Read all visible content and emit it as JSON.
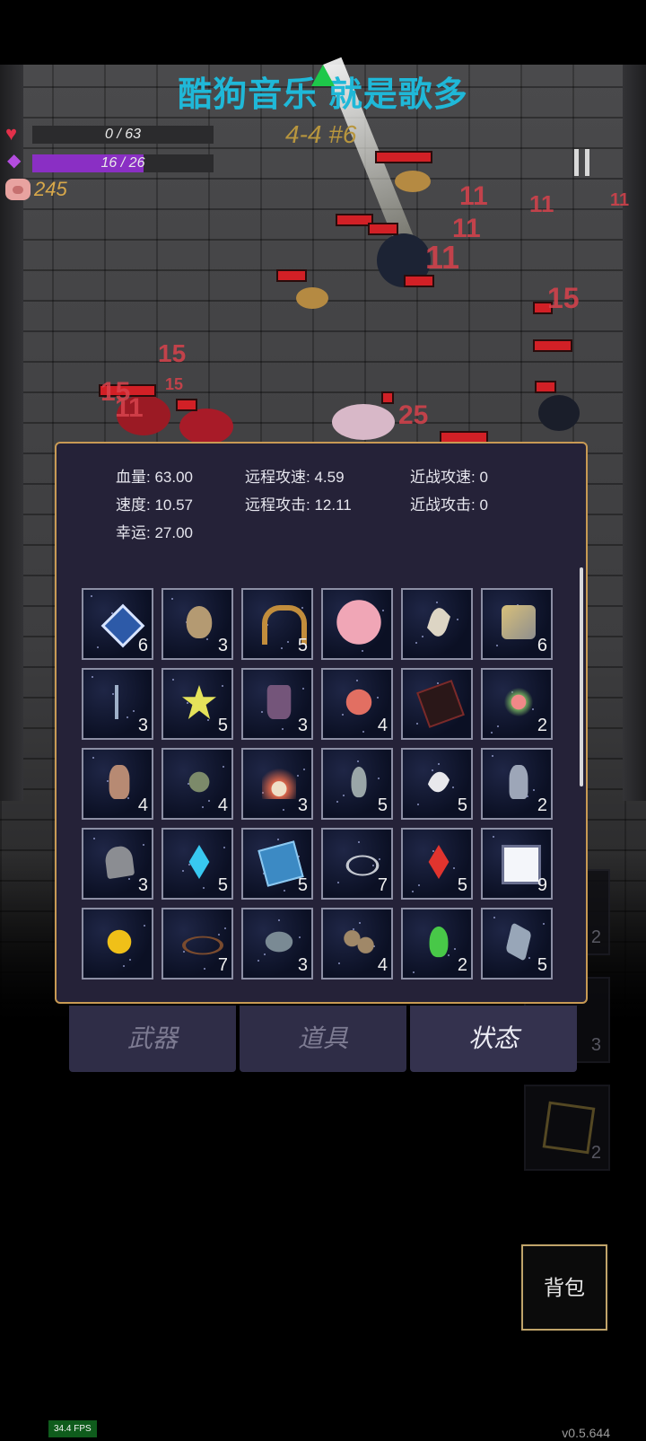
{
  "overlay": {
    "watermark": "酷狗音乐  就是歌多"
  },
  "hud": {
    "hp_text": "0 / 63",
    "hp_fraction": 0.0,
    "mana_text": "16 / 26",
    "mana_fraction": 0.615,
    "coins": "245",
    "stage": "4-4 #6",
    "hp_color": "#e2304a",
    "mana_color": "#8a2fc4"
  },
  "damage_numbers": [
    "11",
    "11",
    "11",
    "11",
    "11",
    "15",
    "15",
    "15",
    "11",
    "15",
    "25"
  ],
  "stats": {
    "hp": {
      "label": "血量:",
      "value": "63.00"
    },
    "ranged_speed": {
      "label": "远程攻速:",
      "value": "4.59"
    },
    "melee_speed": {
      "label": "近战攻速:",
      "value": "0"
    },
    "speed": {
      "label": "速度:",
      "value": "10.57"
    },
    "ranged_attack": {
      "label": "远程攻击:",
      "value": "12.11"
    },
    "melee_attack": {
      "label": "近战攻击:",
      "value": "0"
    },
    "luck": {
      "label": "幸运:",
      "value": "27.00"
    }
  },
  "items": [
    {
      "icon": "blue-diamond-icon",
      "count": "6"
    },
    {
      "icon": "egg-icon",
      "count": "3"
    },
    {
      "icon": "horseshoe-icon",
      "count": "5"
    },
    {
      "icon": "piggy-bank-icon",
      "count": ""
    },
    {
      "icon": "fang-icon",
      "count": ""
    },
    {
      "icon": "gold-stones-icon",
      "count": "6"
    },
    {
      "icon": "arrow-hook-icon",
      "count": "3"
    },
    {
      "icon": "spiked-star-icon",
      "count": "5"
    },
    {
      "icon": "boots-icon",
      "count": "3"
    },
    {
      "icon": "apple-icon",
      "count": "4"
    },
    {
      "icon": "demon-book-icon",
      "count": ""
    },
    {
      "icon": "flower-garland-icon",
      "count": "2"
    },
    {
      "icon": "vase-icon",
      "count": "4"
    },
    {
      "icon": "tentacle-icon",
      "count": "4"
    },
    {
      "icon": "feather-mask-icon",
      "count": "3"
    },
    {
      "icon": "flask-icon",
      "count": "5"
    },
    {
      "icon": "quill-icon",
      "count": "5"
    },
    {
      "icon": "ghost-cloak-icon",
      "count": "2"
    },
    {
      "icon": "tombstone-icon",
      "count": "3"
    },
    {
      "icon": "crystal-shard-icon",
      "count": "5"
    },
    {
      "icon": "spellbook-icon",
      "count": "5"
    },
    {
      "icon": "rings-icon",
      "count": "7"
    },
    {
      "icon": "red-crystal-icon",
      "count": "5"
    },
    {
      "icon": "medkit-icon",
      "count": "9"
    },
    {
      "icon": "gold-coin-icon",
      "count": ""
    },
    {
      "icon": "thorn-crown-icon",
      "count": "7"
    },
    {
      "icon": "rock-icon",
      "count": "3"
    },
    {
      "icon": "pebbles-icon",
      "count": "4"
    },
    {
      "icon": "green-potion-icon",
      "count": "2"
    },
    {
      "icon": "hammer-icon",
      "count": "5"
    }
  ],
  "tabs": {
    "weapons": "武器",
    "props": "道具",
    "status": "状态"
  },
  "side_slots": [
    {
      "count": "2"
    },
    {
      "count": "3"
    },
    {
      "count": "2"
    }
  ],
  "backpack_label": "背包",
  "fps": "34.4 FPS",
  "version": "v0.5.644"
}
